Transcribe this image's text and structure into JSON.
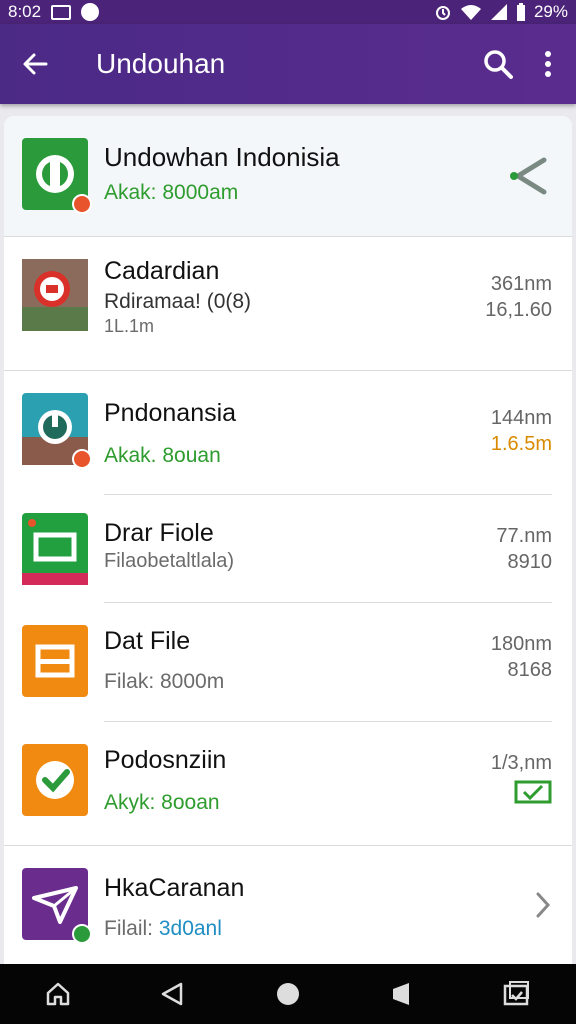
{
  "status_bar": {
    "time": "8:02",
    "battery": "29%"
  },
  "app_bar": {
    "title": "Undouhan"
  },
  "rows": [
    {
      "name": "Undowhan Indonisia",
      "sub": "Akak: 8000am"
    },
    {
      "name": "Cadardian",
      "sub": "Rdiramaa! (0(8)",
      "sub2": "1L.1m",
      "right1": "361nm",
      "right2": "16,1.60"
    },
    {
      "name": "Pndonansia",
      "sub": "Akak. 8ouan",
      "right1": "144nm",
      "right2": "1.6.5m"
    },
    {
      "name": "Drar Fiole",
      "sub": "Filaobetaltlala)",
      "right1": "77.nm",
      "right2": "8910"
    },
    {
      "name": "Dat File",
      "sub": "Filak: 8000m",
      "right1": "180nm",
      "right2": "8168"
    },
    {
      "name": "Podosnziin",
      "sub": "Akyk: 8ooan",
      "right1": "1/3,nm"
    },
    {
      "name": "HkaCaranan",
      "sub_prefix": "Filail: ",
      "sub_highlight": "3d0anl"
    }
  ],
  "colors": {
    "accent": "#4b2a86",
    "green": "#2e9c2e",
    "blue": "#1f8ec2",
    "orange": "#d98a00"
  }
}
